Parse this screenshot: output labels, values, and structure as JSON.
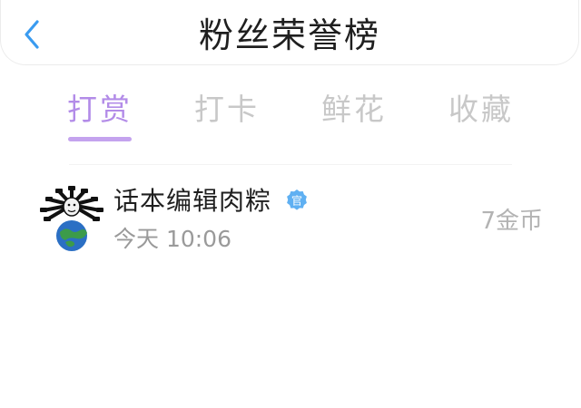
{
  "header": {
    "title": "粉丝荣誉榜",
    "back_icon": "chevron-left-icon"
  },
  "tabs": [
    {
      "label": "打赏",
      "active": true
    },
    {
      "label": "打卡",
      "active": false
    },
    {
      "label": "鲜花",
      "active": false
    },
    {
      "label": "收藏",
      "active": false
    }
  ],
  "list": {
    "items": [
      {
        "name": "话本编辑肉粽",
        "badge": "官",
        "time": "今天 10:06",
        "amount": "7金币"
      }
    ]
  },
  "colors": {
    "accent": "#b38ce8",
    "indicator": "#c4a3ee",
    "back_icon": "#3a9bf0",
    "badge": "#5fb0f2",
    "inactive_tab": "#c8c8c8"
  }
}
